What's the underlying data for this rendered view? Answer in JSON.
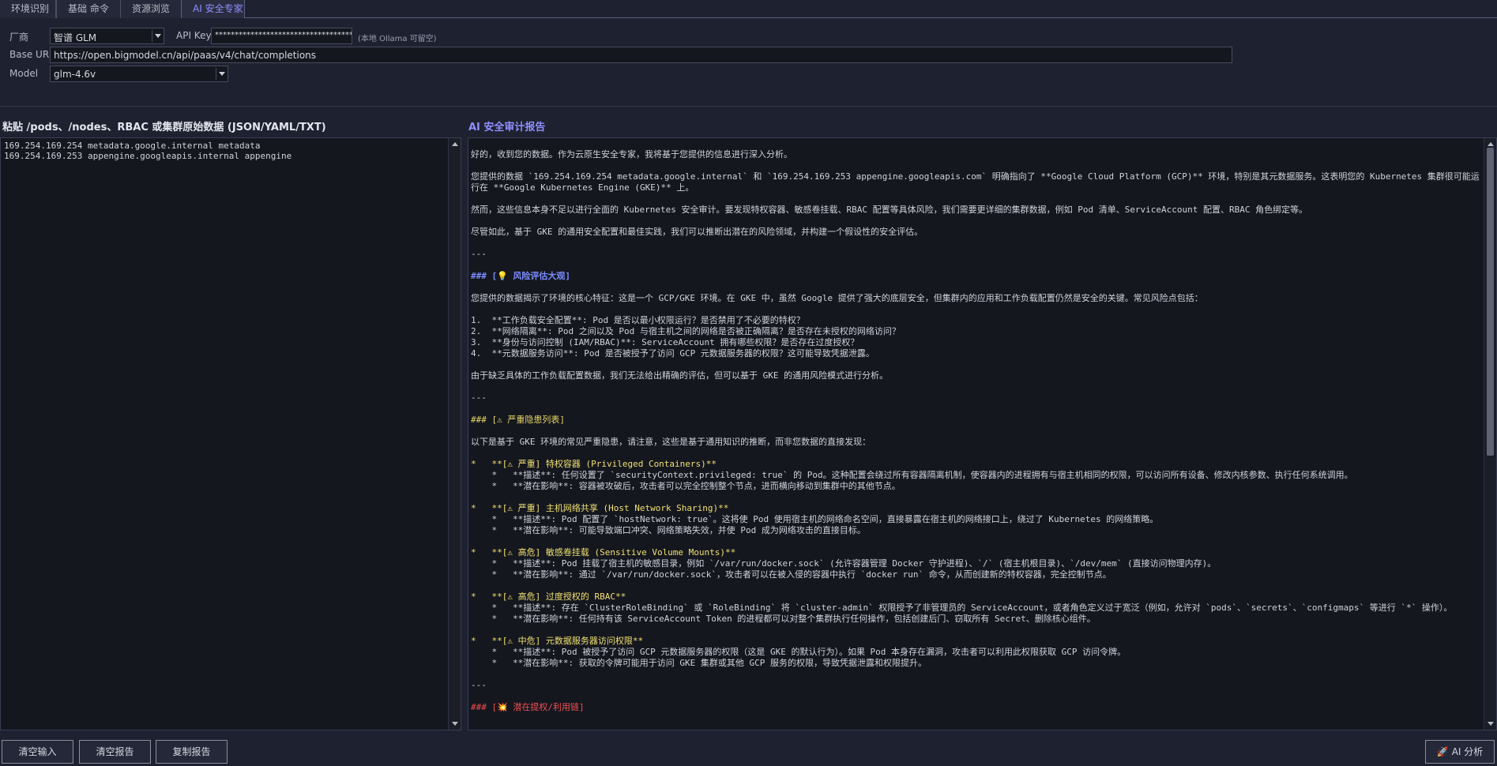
{
  "tabs": [
    {
      "label": "环境识别"
    },
    {
      "label": "基础 命令"
    },
    {
      "label": "资源浏览"
    },
    {
      "label": "AI 安全专家",
      "active": true
    }
  ],
  "config": {
    "vendor_label": "厂商",
    "vendor_value": "智谱 GLM",
    "api_key_label": "API Key",
    "api_key_value": "****************************************",
    "api_key_hint": "(本地 Ollama 可留空)",
    "base_url_label": "Base URL",
    "base_url_value": "https://open.bigmodel.cn/api/paas/v4/chat/completions",
    "model_label": "Model",
    "model_value": "glm-4.6v"
  },
  "input_panel": {
    "title": "粘贴 /pods、/nodes、RBAC 或集群原始数据 (JSON/YAML/TXT)",
    "text": "169.254.169.254 metadata.google.internal metadata\n169.254.169.253 appengine.googleapis.internal appengine"
  },
  "report_panel": {
    "title": "AI 安全审计报告",
    "lines": [
      {
        "t": "好的，收到您的数据。作为云原生安全专家，我将基于您提供的信息进行深入分析。",
        "c": ""
      },
      {
        "t": "",
        "c": ""
      },
      {
        "t": "您提供的数据 `169.254.169.254 metadata.google.internal` 和 `169.254.169.253 appengine.googleapis.com` 明确指向了 **Google Cloud Platform (GCP)** 环境，特别是其元数据服务。这表明您的 Kubernetes 集群很可能运行在 **Google Kubernetes Engine (GKE)** 上。",
        "c": ""
      },
      {
        "t": "",
        "c": ""
      },
      {
        "t": "然而，这些信息本身不足以进行全面的 Kubernetes 安全审计。要发现特权容器、敏感卷挂载、RBAC 配置等具体风险，我们需要更详细的集群数据，例如 Pod 清单、ServiceAccount 配置、RBAC 角色绑定等。",
        "c": ""
      },
      {
        "t": "",
        "c": ""
      },
      {
        "t": "尽管如此，基于 GKE 的通用安全配置和最佳实践，我们可以推断出潜在的风险领域，并构建一个假设性的安全评估。",
        "c": ""
      },
      {
        "t": "",
        "c": ""
      },
      {
        "t": "---",
        "c": ""
      },
      {
        "t": "",
        "c": ""
      },
      {
        "t": "### [💡 风险评估大观]",
        "c": "blue"
      },
      {
        "t": "",
        "c": ""
      },
      {
        "t": "您提供的数据揭示了环境的核心特征：这是一个 GCP/GKE 环境。在 GKE 中，虽然 Google 提供了强大的底层安全，但集群内的应用和工作负载配置仍然是安全的关键。常见风险点包括：",
        "c": ""
      },
      {
        "t": "",
        "c": ""
      },
      {
        "t": "1.  **工作负载安全配置**: Pod 是否以最小权限运行？是否禁用了不必要的特权？",
        "c": ""
      },
      {
        "t": "2.  **网络隔离**: Pod 之间以及 Pod 与宿主机之间的网络是否被正确隔离？是否存在未授权的网络访问？",
        "c": ""
      },
      {
        "t": "3.  **身份与访问控制 (IAM/RBAC)**: ServiceAccount 拥有哪些权限？是否存在过度授权？",
        "c": ""
      },
      {
        "t": "4.  **元数据服务访问**: Pod 是否被授予了访问 GCP 元数据服务器的权限？这可能导致凭据泄露。",
        "c": ""
      },
      {
        "t": "",
        "c": ""
      },
      {
        "t": "由于缺乏具体的工作负载配置数据，我们无法给出精确的评估，但可以基于 GKE 的通用风险模式进行分析。",
        "c": ""
      },
      {
        "t": "",
        "c": ""
      },
      {
        "t": "---",
        "c": ""
      },
      {
        "t": "",
        "c": ""
      },
      {
        "t": "### [⚠ 严重隐患列表]",
        "c": "yellow"
      },
      {
        "t": "",
        "c": ""
      },
      {
        "t": "以下是基于 GKE 环境的常见严重隐患，请注意，这些是基于通用知识的推断，而非您数据的直接发现：",
        "c": ""
      },
      {
        "t": "",
        "c": ""
      },
      {
        "t": "*   **[⚠ 严重] 特权容器 (Privileged Containers)**",
        "c": "ylw"
      },
      {
        "t": "    *   **描述**: 任何设置了 `securityContext.privileged: true` 的 Pod。这种配置会绕过所有容器隔离机制，使容器内的进程拥有与宿主机相同的权限，可以访问所有设备、修改内核参数、执行任何系统调用。",
        "c": ""
      },
      {
        "t": "    *   **潜在影响**: 容器被攻破后，攻击者可以完全控制整个节点，进而横向移动到集群中的其他节点。",
        "c": ""
      },
      {
        "t": "",
        "c": ""
      },
      {
        "t": "*   **[⚠ 严重] 主机网络共享 (Host Network Sharing)**",
        "c": "ylw"
      },
      {
        "t": "    *   **描述**: Pod 配置了 `hostNetwork: true`。这将使 Pod 使用宿主机的网络命名空间，直接暴露在宿主机的网络接口上，绕过了 Kubernetes 的网络策略。",
        "c": ""
      },
      {
        "t": "    *   **潜在影响**: 可能导致端口冲突、网络策略失效，并使 Pod 成为网络攻击的直接目标。",
        "c": ""
      },
      {
        "t": "",
        "c": ""
      },
      {
        "t": "*   **[⚠ 高危] 敏感卷挂载 (Sensitive Volume Mounts)**",
        "c": "ylw"
      },
      {
        "t": "    *   **描述**: Pod 挂载了宿主机的敏感目录，例如 `/var/run/docker.sock` (允许容器管理 Docker 守护进程)、`/` (宿主机根目录)、`/dev/mem` (直接访问物理内存)。",
        "c": ""
      },
      {
        "t": "    *   **潜在影响**: 通过 `/var/run/docker.sock`，攻击者可以在被入侵的容器中执行 `docker run` 命令，从而创建新的特权容器，完全控制节点。",
        "c": ""
      },
      {
        "t": "",
        "c": ""
      },
      {
        "t": "*   **[⚠ 高危] 过度授权的 RBAC**",
        "c": "ylw"
      },
      {
        "t": "    *   **描述**: 存在 `ClusterRoleBinding` 或 `RoleBinding` 将 `cluster-admin` 权限授予了非管理员的 ServiceAccount，或者角色定义过于宽泛（例如，允许对 `pods`、`secrets`、`configmaps` 等进行 `*` 操作）。",
        "c": ""
      },
      {
        "t": "    *   **潜在影响**: 任何持有该 ServiceAccount Token 的进程都可以对整个集群执行任何操作，包括创建后门、窃取所有 Secret、删除核心组件。",
        "c": ""
      },
      {
        "t": "",
        "c": ""
      },
      {
        "t": "*   **[⚠ 中危] 元数据服务器访问权限**",
        "c": "ylw"
      },
      {
        "t": "    *   **描述**: Pod 被授予了访问 GCP 元数据服务器的权限（这是 GKE 的默认行为）。如果 Pod 本身存在漏洞，攻击者可以利用此权限获取 GCP 访问令牌。",
        "c": ""
      },
      {
        "t": "    *   **潜在影响**: 获取的令牌可能用于访问 GKE 集群或其他 GCP 服务的权限，导致凭据泄露和权限提升。",
        "c": ""
      },
      {
        "t": "",
        "c": ""
      },
      {
        "t": "---",
        "c": ""
      },
      {
        "t": "",
        "c": ""
      },
      {
        "t": "### [💥 潜在提权/利用链]",
        "c": "red"
      }
    ]
  },
  "buttons": {
    "clear_input": "清空输入",
    "clear_report": "清空报告",
    "copy_report": "复制报告",
    "ai_analyze": "AI 分析"
  }
}
